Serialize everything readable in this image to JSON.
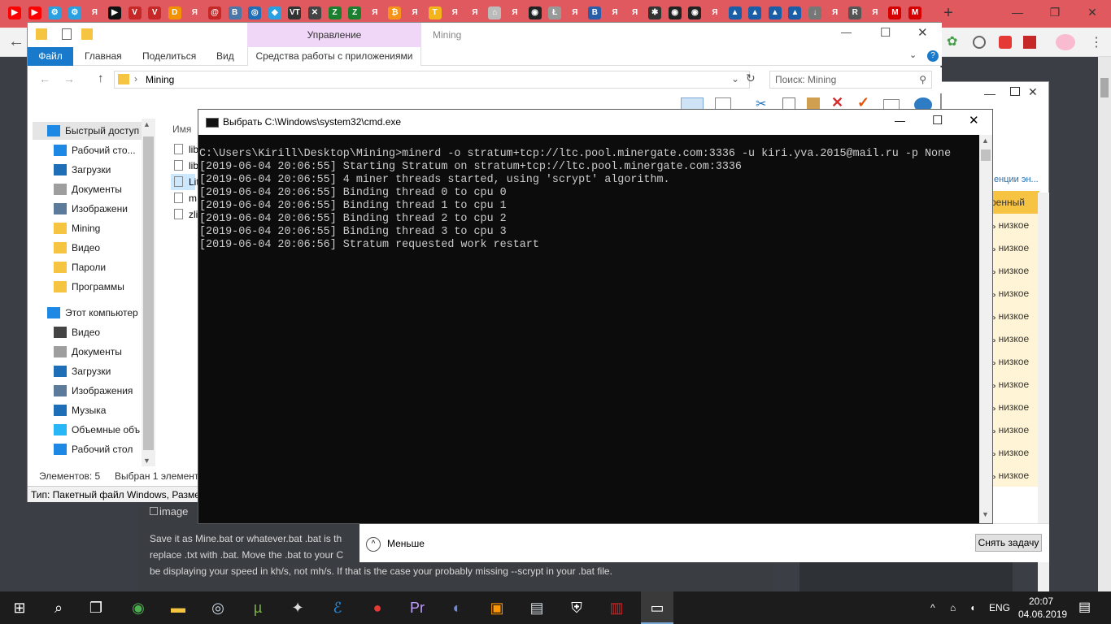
{
  "browser": {
    "tab_icons": [
      {
        "name": "youtube-icon",
        "color": "#ff0000",
        "glyph": "▶"
      },
      {
        "name": "youtube-icon",
        "color": "#ff0000",
        "glyph": "▶"
      },
      {
        "name": "settings-icon",
        "color": "#2aa0e0",
        "glyph": "⚙"
      },
      {
        "name": "settings-icon",
        "color": "#2aa0e0",
        "glyph": "⚙"
      },
      {
        "name": "yandex-icon",
        "color": "#e0595f",
        "glyph": "Я"
      },
      {
        "name": "play-icon",
        "color": "#111",
        "glyph": "▶"
      },
      {
        "name": "vivaldi-icon",
        "color": "#c62828",
        "glyph": "V"
      },
      {
        "name": "vivaldi-icon",
        "color": "#c62828",
        "glyph": "V"
      },
      {
        "name": "dns-icon",
        "color": "#f39200",
        "glyph": "D"
      },
      {
        "name": "yandex-icon",
        "color": "#e0595f",
        "glyph": "Я"
      },
      {
        "name": "mail-icon",
        "color": "#c62828",
        "glyph": "@"
      },
      {
        "name": "vk-icon",
        "color": "#4a76a8",
        "glyph": "В"
      },
      {
        "name": "coin-icon",
        "color": "#1e6fb8",
        "glyph": "◎"
      },
      {
        "name": "diamond-icon",
        "color": "#2aa0e0",
        "glyph": "◆"
      },
      {
        "name": "vt-icon",
        "color": "#333",
        "glyph": "VT"
      },
      {
        "name": "close-icon",
        "color": "#444",
        "glyph": "✕"
      },
      {
        "name": "zcash-icon",
        "color": "#1a7f2e",
        "glyph": "Z"
      },
      {
        "name": "zcash-icon",
        "color": "#1a7f2e",
        "glyph": "Z"
      },
      {
        "name": "yandex-icon",
        "color": "#e0595f",
        "glyph": "Я"
      },
      {
        "name": "bitcoin-icon",
        "color": "#f7931a",
        "glyph": "₿"
      },
      {
        "name": "yandex-icon",
        "color": "#e0595f",
        "glyph": "Я"
      },
      {
        "name": "tether-icon",
        "color": "#f3b51b",
        "glyph": "T"
      },
      {
        "name": "yandex-icon",
        "color": "#e0595f",
        "glyph": "Я"
      },
      {
        "name": "yandex-icon",
        "color": "#e0595f",
        "glyph": "Я"
      },
      {
        "name": "robot-icon",
        "color": "#bbb",
        "glyph": "⌂"
      },
      {
        "name": "yandex-icon",
        "color": "#e0595f",
        "glyph": "Я"
      },
      {
        "name": "github-icon",
        "color": "#222",
        "glyph": "◉"
      },
      {
        "name": "litecoin-icon",
        "color": "#999",
        "glyph": "Ł"
      },
      {
        "name": "yandex-icon",
        "color": "#e0595f",
        "glyph": "Я"
      },
      {
        "name": "b-icon",
        "color": "#2a5ea8",
        "glyph": "B"
      },
      {
        "name": "yandex-icon",
        "color": "#e0595f",
        "glyph": "Я"
      },
      {
        "name": "yandex-icon",
        "color": "#e0595f",
        "glyph": "Я"
      },
      {
        "name": "network-icon",
        "color": "#333",
        "glyph": "✱"
      },
      {
        "name": "github-icon",
        "color": "#222",
        "glyph": "◉"
      },
      {
        "name": "github-icon",
        "color": "#222",
        "glyph": "◉"
      },
      {
        "name": "yandex-icon",
        "color": "#e0595f",
        "glyph": "Я"
      },
      {
        "name": "mountain-icon",
        "color": "#1a5ea8",
        "glyph": "▲"
      },
      {
        "name": "mountain-icon",
        "color": "#1a5ea8",
        "glyph": "▲"
      },
      {
        "name": "mountain-icon",
        "color": "#1a5ea8",
        "glyph": "▲"
      },
      {
        "name": "mountain-icon",
        "color": "#1a5ea8",
        "glyph": "▲"
      },
      {
        "name": "download-icon",
        "color": "#777",
        "glyph": "↓"
      },
      {
        "name": "yandex-icon",
        "color": "#e0595f",
        "glyph": "Я"
      },
      {
        "name": "r-icon",
        "color": "#555",
        "glyph": "R"
      },
      {
        "name": "yandex-icon",
        "color": "#e0595f",
        "glyph": "Я"
      },
      {
        "name": "m-icon",
        "color": "#d50000",
        "glyph": "M"
      },
      {
        "name": "m-icon",
        "color": "#d50000",
        "glyph": "M"
      }
    ],
    "new_tab": "+",
    "minimize": "—",
    "maximize": "❐",
    "close": "✕",
    "back": "←"
  },
  "page": {
    "image_alt": "image",
    "line1": "Save it as Mine.bat or whatever.bat  .bat is th",
    "line2": "replace .txt with .bat.  Move the .bat to your C",
    "line3": "be displaying your speed in kh/s, not mh/s.  If that is the case your probably missing --scrypt in your .bat file."
  },
  "explorer": {
    "contextual_group": "Управление",
    "window_title": "Mining",
    "tabs": {
      "file": "Файл",
      "home": "Главная",
      "share": "Поделиться",
      "view": "Вид",
      "app_tools": "Средства работы с приложениями"
    },
    "minimize": "—",
    "maximize": "☐",
    "close": "✕",
    "back": "←",
    "forward": "→",
    "up": "↑",
    "address": "Mining",
    "search_placeholder": "Поиск: Mining",
    "column_name": "Имя",
    "files": [
      "lib",
      "lib",
      "Lit",
      "m",
      "zli"
    ],
    "nav": {
      "quick_access": "Быстрый доступ",
      "desktop": "Рабочий сто...",
      "downloads": "Загрузки",
      "documents": "Документы",
      "pictures": "Изображени",
      "mining": "Mining",
      "video": "Видео",
      "passwords": "Пароли",
      "programs": "Программы",
      "this_pc": "Этот компьютер",
      "pc_video": "Видео",
      "pc_documents": "Документы",
      "pc_downloads": "Загрузки",
      "pc_pictures": "Изображения",
      "pc_music": "Музыка",
      "pc_3d": "Объемные объ",
      "pc_desktop": "Рабочий стол"
    },
    "status_items": "Элементов: 5",
    "status_selected": "Выбран 1 элемент",
    "tooltip": "Тип: Пакетный файл Windows, Размер"
  },
  "taskmgr": {
    "header_frag": "енции эн...",
    "header_col": "ренный",
    "rows": [
      "ь низкое",
      "ь низкое",
      "ь низкое",
      "ь низкое",
      "ь низкое",
      "ь низкое",
      "ь низкое",
      "ь низкое",
      "ь низкое",
      "ь низкое",
      "ь низкое",
      "ь низкое"
    ],
    "fewer": "Меньше",
    "end_task": "Снять задачу"
  },
  "cmd": {
    "title": "Выбрать C:\\Windows\\system32\\cmd.exe",
    "minimize": "—",
    "maximize": "☐",
    "close": "✕",
    "lines": [
      "C:\\Users\\Kirill\\Desktop\\Mining>minerd -o stratum+tcp://ltc.pool.minergate.com:3336 -u kiri.yva.2015@mail.ru -p None",
      "[2019-06-04 20:06:55] Starting Stratum on stratum+tcp://ltc.pool.minergate.com:3336",
      "[2019-06-04 20:06:55] 4 miner threads started, using 'scrypt' algorithm.",
      "[2019-06-04 20:06:55] Binding thread 0 to cpu 0",
      "[2019-06-04 20:06:55] Binding thread 1 to cpu 1",
      "[2019-06-04 20:06:55] Binding thread 2 to cpu 2",
      "[2019-06-04 20:06:55] Binding thread 3 to cpu 3",
      "[2019-06-04 20:06:56] Stratum requested work restart"
    ]
  },
  "taskbar": {
    "apps": [
      {
        "name": "start-icon",
        "glyph": "⊞",
        "color": "#ffffff"
      },
      {
        "name": "search-icon",
        "glyph": "⌕",
        "color": "#ffffff"
      },
      {
        "name": "task-view-icon",
        "glyph": "❐",
        "color": "#ffffff"
      },
      {
        "name": "chrome-icon",
        "glyph": "◉",
        "color": "#4caf50"
      },
      {
        "name": "folder-icon",
        "glyph": "▬",
        "color": "#f5c542"
      },
      {
        "name": "steam-icon",
        "glyph": "◎",
        "color": "#c7d5e0"
      },
      {
        "name": "utorrent-icon",
        "glyph": "µ",
        "color": "#7cb342"
      },
      {
        "name": "game-icon",
        "glyph": "✦",
        "color": "#dddddd"
      },
      {
        "name": "app-icon",
        "glyph": "ℰ",
        "color": "#2196f3"
      },
      {
        "name": "record-icon",
        "glyph": "●",
        "color": "#e53935"
      },
      {
        "name": "premiere-icon",
        "glyph": "Pr",
        "color": "#c39cff"
      },
      {
        "name": "discord-icon",
        "glyph": "◐",
        "color": "#7289da"
      },
      {
        "name": "cube-icon",
        "glyph": "▣",
        "color": "#ff9800"
      },
      {
        "name": "image-icon",
        "glyph": "▤",
        "color": "#cfd8dc"
      },
      {
        "name": "shield-icon",
        "glyph": "⛨",
        "color": "#ffffff"
      },
      {
        "name": "archive-icon",
        "glyph": "▥",
        "color": "#c62828"
      },
      {
        "name": "cmd-icon",
        "glyph": "▭",
        "color": "#ffffff"
      }
    ],
    "tray_chevron": "^",
    "lang": "ENG",
    "time": "20:07",
    "date": "04.06.2019",
    "notification": "▤"
  }
}
